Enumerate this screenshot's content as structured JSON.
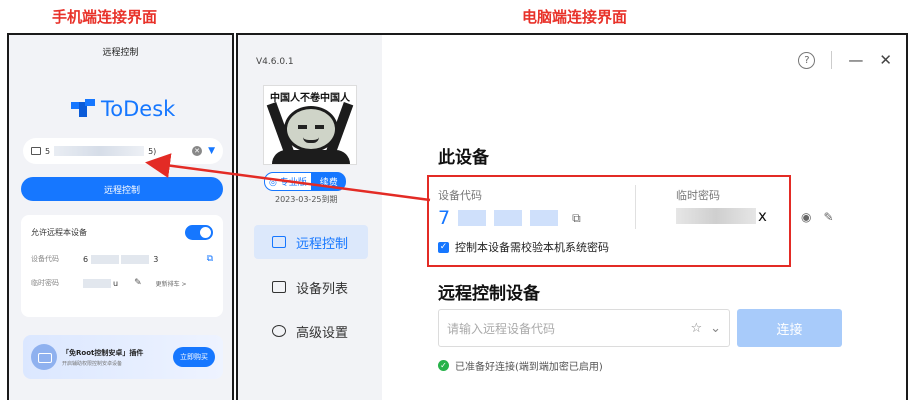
{
  "captions": {
    "phone": "手机端连接界面",
    "pc": "电脑端连接界面"
  },
  "phone": {
    "title": "远程控制",
    "logo": "ToDesk",
    "device_prefix": "5",
    "device_suffix": "5)",
    "remote_button": "远程控制",
    "allow_label": "允许远程本设备",
    "allow_toggle": true,
    "code_label": "设备代码",
    "code_start": "6",
    "code_end": "3",
    "pwd_label": "临时密码",
    "pwd_end": "u",
    "refresh": "更新排车 >",
    "promo_title": "「免Root控制安卓」插件",
    "promo_sub": "开启辅助权限控制安卓设备",
    "promo_button": "立即购买"
  },
  "pc": {
    "version": "V4.6.0.1",
    "avatar_caption": "中国人不卷中国人",
    "badge_pro": "专业版",
    "badge_renew": "续费",
    "expire": "2023-03-25到期",
    "nav": [
      {
        "label": "远程控制",
        "icon": "monitor-icon",
        "active": true
      },
      {
        "label": "设备列表",
        "icon": "device-list-icon",
        "active": false
      },
      {
        "label": "高级设置",
        "icon": "settings-icon",
        "active": false
      }
    ],
    "help_icon": "?",
    "minimize": "—",
    "close": "✕",
    "this_device": "此设备",
    "code_label": "设备代码",
    "code_first_digit": "7",
    "pwd_label": "临时密码",
    "pwd_last_char": "x",
    "checkbox_label": "控制本设备需校验本机系统密码",
    "checkbox_checked": true,
    "remote_heading": "远程控制设备",
    "remote_placeholder": "请输入远程设备代码",
    "connect_button": "连接",
    "status_text": "已准备好连接(端到端加密已启用)"
  },
  "colors": {
    "accent": "#1677ff",
    "highlight": "#e32b25",
    "success": "#27b24a"
  }
}
